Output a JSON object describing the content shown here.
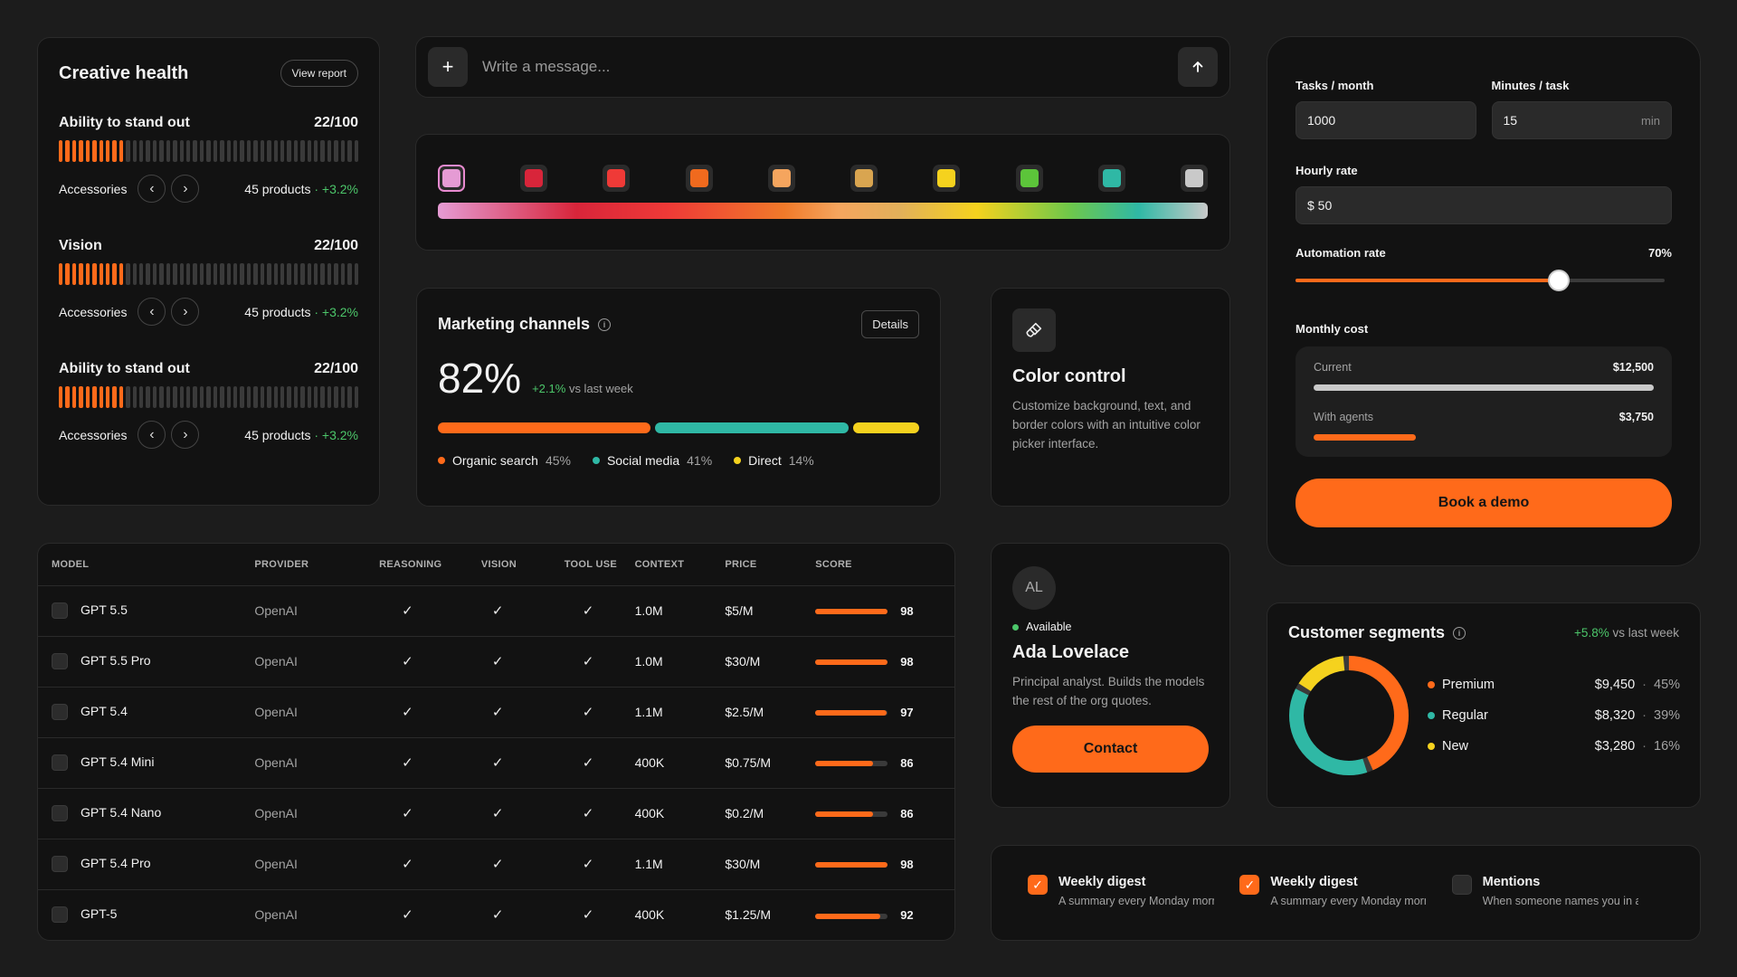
{
  "health": {
    "title": "Creative health",
    "view_report": "View report",
    "metrics": [
      {
        "name": "Ability to stand out",
        "score": "22/100",
        "level": 0.22,
        "label": "Accessories",
        "count": "45 products",
        "delta": "· +3.2%"
      },
      {
        "name": "Vision",
        "score": "22/100",
        "level": 0.22,
        "label": "Accessories",
        "count": "45 products",
        "delta": "· +3.2%"
      },
      {
        "name": "Ability to stand out",
        "score": "22/100",
        "level": 0.22,
        "label": "Accessories",
        "count": "45 products",
        "delta": "· +3.2%"
      }
    ]
  },
  "message": {
    "placeholder": "Write a message...",
    "add_icon": "plus-icon",
    "send_icon": "arrow-up-icon"
  },
  "palette": {
    "swatches": [
      "#e59bd4",
      "#d8253a",
      "#ef3a37",
      "#f06a1e",
      "#f5a55e",
      "#d9a550",
      "#f5d21e",
      "#5cc43a",
      "#2fb8a5",
      "#c9c9c9"
    ],
    "selected_index": 0
  },
  "marketing": {
    "title": "Marketing channels",
    "details": "Details",
    "percent": "82%",
    "delta": "+2.1%",
    "delta_suffix": "vs last week",
    "channels": [
      {
        "name": "Organic search",
        "pct": "45%",
        "value": 45,
        "color": "#ff6a1a"
      },
      {
        "name": "Social media",
        "pct": "41%",
        "value": 41,
        "color": "#2fb8a5"
      },
      {
        "name": "Direct",
        "pct": "14%",
        "value": 14,
        "color": "#f5d21e"
      }
    ]
  },
  "color_control": {
    "title": "Color control",
    "description": "Customize background, text, and border colors with an intuitive color picker interface.",
    "icon": "paintbrush-icon"
  },
  "models": {
    "columns": [
      "MODEL",
      "PROVIDER",
      "REASONING",
      "VISION",
      "TOOL USE",
      "CONTEXT",
      "PRICE",
      "SCORE"
    ],
    "rows": [
      {
        "model": "GPT 5.5",
        "provider": "OpenAI",
        "context": "1.0M",
        "price": "$5/M",
        "score": "98",
        "score_value": 98
      },
      {
        "model": "GPT 5.5 Pro",
        "provider": "OpenAI",
        "context": "1.0M",
        "price": "$30/M",
        "score": "98",
        "score_value": 98
      },
      {
        "model": "GPT 5.4",
        "provider": "OpenAI",
        "context": "1.1M",
        "price": "$2.5/M",
        "score": "97",
        "score_value": 97
      },
      {
        "model": "GPT 5.4 Mini",
        "provider": "OpenAI",
        "context": "400K",
        "price": "$0.75/M",
        "score": "86",
        "score_value": 86
      },
      {
        "model": "GPT 5.4 Nano",
        "provider": "OpenAI",
        "context": "400K",
        "price": "$0.2/M",
        "score": "86",
        "score_value": 86
      },
      {
        "model": "GPT 5.4 Pro",
        "provider": "OpenAI",
        "context": "1.1M",
        "price": "$30/M",
        "score": "98",
        "score_value": 98
      },
      {
        "model": "GPT-5",
        "provider": "OpenAI",
        "context": "400K",
        "price": "$1.25/M",
        "score": "92",
        "score_value": 92
      }
    ]
  },
  "profile": {
    "initials": "AL",
    "status": "Available",
    "name": "Ada Lovelace",
    "bio": "Principal analyst. Builds the models the rest of the org quotes.",
    "contact": "Contact"
  },
  "calculator": {
    "tasks_label": "Tasks / month",
    "tasks_value": "1000",
    "minutes_label": "Minutes / task",
    "minutes_value": "15",
    "minutes_unit": "min",
    "rate_label": "Hourly rate",
    "rate_value": "$ 50",
    "automation_label": "Automation rate",
    "automation_pct": "70%",
    "automation_value": 0.7,
    "monthly_label": "Monthly cost",
    "current_label": "Current",
    "current_amount": "$12,500",
    "current_ratio": 1.0,
    "agents_label": "With agents",
    "agents_amount": "$3,750",
    "agents_ratio": 0.3,
    "cta": "Book a demo"
  },
  "segments": {
    "title": "Customer segments",
    "delta": "+5.8%",
    "delta_suffix": "vs last week",
    "items": [
      {
        "name": "Premium",
        "amount": "$9,450",
        "pct": "45%",
        "value": 45,
        "color": "#ff6a1a"
      },
      {
        "name": "Regular",
        "amount": "$8,320",
        "pct": "39%",
        "value": 39,
        "color": "#2fb8a5"
      },
      {
        "name": "New",
        "amount": "$3,280",
        "pct": "16%",
        "value": 16,
        "color": "#f5d21e"
      }
    ]
  },
  "notifications": [
    {
      "title": "Weekly digest",
      "desc": "A summary every Monday morning",
      "checked": true
    },
    {
      "title": "Weekly digest",
      "desc": "A summary every Monday morning",
      "checked": true
    },
    {
      "title": "Mentions",
      "desc": "When someone names you in a thread",
      "checked": false
    }
  ]
}
